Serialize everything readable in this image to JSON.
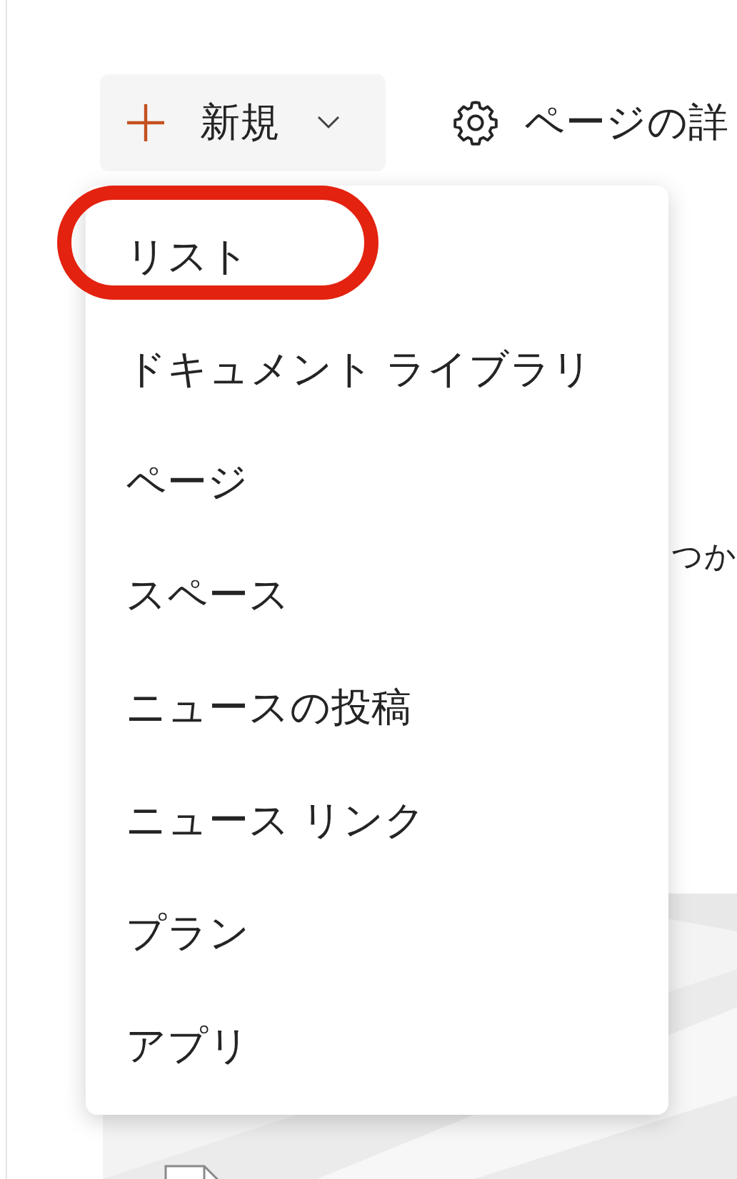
{
  "toolbar": {
    "new_button": {
      "label": "新規"
    },
    "page_details": {
      "label": "ページの詳"
    }
  },
  "background_text": "つか",
  "menu": {
    "items": [
      {
        "label": "リスト",
        "circled": true
      },
      {
        "label": "ドキュメント ライブラリ",
        "circled": false
      },
      {
        "label": "ページ",
        "circled": false
      },
      {
        "label": "スペース",
        "circled": false
      },
      {
        "label": "ニュースの投稿",
        "circled": false
      },
      {
        "label": "ニュース リンク",
        "circled": false
      },
      {
        "label": "プラン",
        "circled": false
      },
      {
        "label": "アプリ",
        "circled": false
      }
    ]
  }
}
